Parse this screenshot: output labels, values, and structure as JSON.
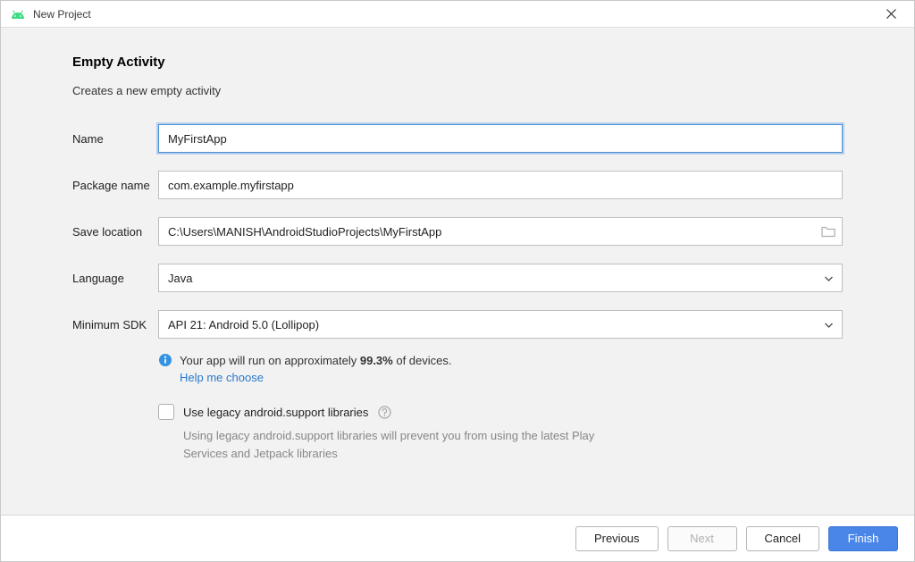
{
  "window": {
    "title": "New Project"
  },
  "form": {
    "section_title": "Empty Activity",
    "section_desc": "Creates a new empty activity",
    "name_label": "Name",
    "name_value": "MyFirstApp",
    "package_label": "Package name",
    "package_value": "com.example.myfirstapp",
    "location_label": "Save location",
    "location_value": "C:\\Users\\MANISH\\AndroidStudioProjects\\MyFirstApp",
    "language_label": "Language",
    "language_value": "Java",
    "sdk_label": "Minimum SDK",
    "sdk_value": "API 21: Android 5.0 (Lollipop)",
    "info_prefix": "Your app will run on approximately ",
    "info_percent": "99.3%",
    "info_suffix": " of devices.",
    "help_link": "Help me choose",
    "legacy_label": "Use legacy android.support libraries",
    "legacy_desc": "Using legacy android.support libraries will prevent you from using the latest Play Services and Jetpack libraries"
  },
  "footer": {
    "previous": "Previous",
    "next": "Next",
    "cancel": "Cancel",
    "finish": "Finish"
  }
}
